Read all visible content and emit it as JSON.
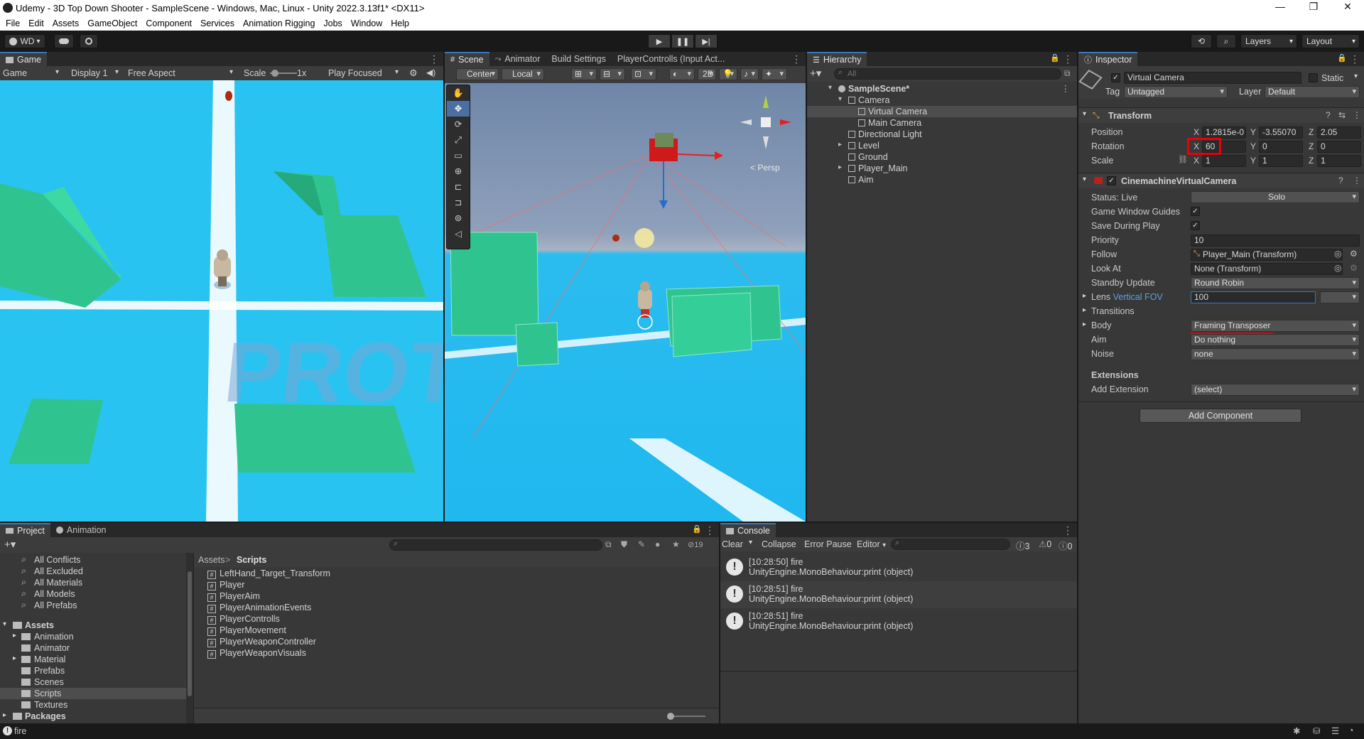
{
  "window": {
    "title": "Udemy - 3D Top Down Shooter - SampleScene - Windows, Mac, Linux - Unity 2022.3.13f1* <DX11>",
    "minimize": "—",
    "maximize": "❐",
    "close": "✕"
  },
  "menu": [
    "File",
    "Edit",
    "Assets",
    "GameObject",
    "Component",
    "Services",
    "Animation Rigging",
    "Jobs",
    "Window",
    "Help"
  ],
  "toolbar": {
    "account": "WD",
    "layers": "Layers",
    "layout": "Layout"
  },
  "game": {
    "tab": "Game",
    "mode": "Game",
    "display": "Display 1",
    "aspect": "Free Aspect",
    "scale_label": "Scale",
    "scale_value": "1x",
    "play_focused": "Play Focused",
    "floor_text": "PROTO"
  },
  "scene": {
    "tabs": [
      "Scene",
      "Animator",
      "Build Settings",
      "PlayerControlls (Input Act..."
    ],
    "pivot": "Center",
    "space": "Local",
    "mode_2d": "2D",
    "persp": "< Persp"
  },
  "hierarchy": {
    "tab": "Hierarchy",
    "search_placeholder": "All",
    "items": [
      {
        "label": "SampleScene*",
        "indent": 0,
        "fold": "▾"
      },
      {
        "label": "Camera",
        "indent": 1,
        "fold": "▾"
      },
      {
        "label": "Virtual Camera",
        "indent": 2,
        "fold": "",
        "selected": true
      },
      {
        "label": "Main Camera",
        "indent": 2,
        "fold": ""
      },
      {
        "label": "Directional Light",
        "indent": 1,
        "fold": ""
      },
      {
        "label": "Level",
        "indent": 1,
        "fold": "▸"
      },
      {
        "label": "Ground",
        "indent": 1,
        "fold": ""
      },
      {
        "label": "Player_Main",
        "indent": 1,
        "fold": "▸"
      },
      {
        "label": "Aim",
        "indent": 1,
        "fold": ""
      }
    ]
  },
  "inspector": {
    "tab": "Inspector",
    "object_name": "Virtual Camera",
    "static_label": "Static",
    "tag_label": "Tag",
    "tag_value": "Untagged",
    "layer_label": "Layer",
    "layer_value": "Default",
    "transform": {
      "title": "Transform",
      "position_label": "Position",
      "position": {
        "x": "1.2815e-0",
        "y": "-3.55070",
        "z": "2.05"
      },
      "rotation_label": "Rotation",
      "rotation": {
        "x": "60",
        "y": "0",
        "z": "0"
      },
      "scale_label": "Scale",
      "scale": {
        "x": "1",
        "y": "1",
        "z": "1"
      }
    },
    "cinemachine": {
      "title": "CinemachineVirtualCamera",
      "status_label": "Status: Live",
      "solo": "Solo",
      "game_window_guides": "Game Window Guides",
      "save_during_play": "Save During Play",
      "priority_label": "Priority",
      "priority_value": "10",
      "follow_label": "Follow",
      "follow_value": "Player_Main (Transform)",
      "look_at_label": "Look At",
      "look_at_value": "None (Transform)",
      "standby_label": "Standby Update",
      "standby_value": "Round Robin",
      "lens_label": "Lens",
      "lens_link": "Vertical FOV",
      "lens_value": "100",
      "transitions": "Transitions",
      "body_label": "Body",
      "body_value": "Framing Transposer",
      "aim_label": "Aim",
      "aim_value": "Do nothing",
      "noise_label": "Noise",
      "noise_value": "none",
      "extensions": "Extensions",
      "add_extension_label": "Add Extension",
      "add_extension_value": "(select)"
    },
    "add_component": "Add Component"
  },
  "project": {
    "tabs": [
      "Project",
      "Animation"
    ],
    "hidden_count": "19",
    "favorites": [
      "All Conflicts",
      "All Excluded",
      "All Materials",
      "All Models",
      "All Prefabs"
    ],
    "assets_root": "Assets",
    "folders": [
      {
        "label": "Animation",
        "fold": "▸"
      },
      {
        "label": "Animator",
        "fold": ""
      },
      {
        "label": "Material",
        "fold": "▸"
      },
      {
        "label": "Prefabs",
        "fold": ""
      },
      {
        "label": "Scenes",
        "fold": ""
      },
      {
        "label": "Scripts",
        "fold": "",
        "selected": true
      },
      {
        "label": "Textures",
        "fold": ""
      }
    ],
    "packages": "Packages",
    "breadcrumb_root": "Assets",
    "breadcrumb_sep": ">",
    "breadcrumb_current": "Scripts",
    "scripts": [
      "LeftHand_Target_Transform",
      "Player",
      "PlayerAim",
      "PlayerAnimationEvents",
      "PlayerControlls",
      "PlayerMovement",
      "PlayerWeaponController",
      "PlayerWeaponVisuals"
    ]
  },
  "console": {
    "tab": "Console",
    "clear": "Clear",
    "collapse": "Collapse",
    "error_pause": "Error Pause",
    "editor": "Editor",
    "info_count": "3",
    "warn_count": "0",
    "error_count": "0",
    "messages": [
      {
        "line1": "[10:28:50] fire",
        "line2": "UnityEngine.MonoBehaviour:print (object)"
      },
      {
        "line1": "[10:28:51] fire",
        "line2": "UnityEngine.MonoBehaviour:print (object)"
      },
      {
        "line1": "[10:28:51] fire",
        "line2": "UnityEngine.MonoBehaviour:print (object)"
      }
    ]
  },
  "status": {
    "message": "fire"
  },
  "colors": {
    "highlight": "#e8000b",
    "accent": "#3a79bb",
    "cube": "#2fc48f",
    "sky": "#29c3f2"
  }
}
